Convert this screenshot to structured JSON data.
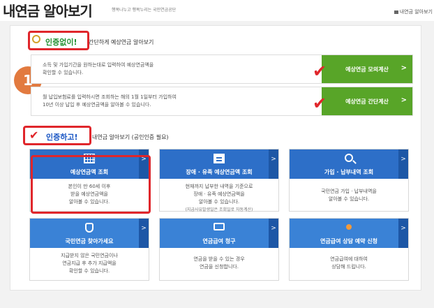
{
  "header": {
    "title": "내연금 알아보기",
    "subtitle": "행복나누고 행복누리는 국민연금공단",
    "breadcrumb": "내연금 알아보기"
  },
  "annotation": {
    "step_number": "1"
  },
  "section_no_auth": {
    "label": "인증없이!",
    "description": "간단하게 예상연금 알아보기",
    "rows": [
      {
        "text_line1": "소득 및 가입기간을 원하는대로 입력하여 예상연금액을",
        "text_line2": "확인할 수 있습니다.",
        "button": "예상연금 모의계산"
      },
      {
        "text_line1": "월 납입보험료를 입력하시면 조회하는 해의 1월 1일부터 가입하여",
        "text_line2": "10년 이상 납입 후 예상연금액을 알아볼 수 있습니다.",
        "button": "예상연금 간단계산"
      }
    ]
  },
  "section_auth": {
    "label": "인증하고!",
    "description": "내연금 알아보기 (공인인증 필요)",
    "cards": [
      {
        "title": "예상연금액 조회",
        "icon": "grid-icon",
        "body": [
          "본인이 만 60세 이후",
          "받을 예상연금액을",
          "알아볼 수 있습니다."
        ],
        "note": ""
      },
      {
        "title": "장애 · 유족 예상연금액 조회",
        "icon": "document-icon",
        "body": [
          "현재까지 납부한 내역을 기준으로",
          "장애 · 유족 예상연금액을",
          "알아볼 수 있습니다."
        ],
        "note": "(지급사유발생일은 조회일로 자동계산)"
      },
      {
        "title": "가입 · 납부내역 조회",
        "icon": "search-icon",
        "body": [
          "국민연금 가입 · 납부내역을",
          "알아볼 수 있습니다."
        ],
        "note": ""
      },
      {
        "title": "국민연금 찾아가세요",
        "icon": "jar-icon",
        "body": [
          "지급받지 않은 국민연금이나",
          "연금지급 후 추가 지급액을",
          "확인할 수 있습니다."
        ],
        "note": ""
      },
      {
        "title": "연금급여 청구",
        "icon": "computer-icon",
        "body": [
          "연금을 받을 수 있는 경우",
          "연금을 신청합니다."
        ],
        "note": ""
      },
      {
        "title": "연금급여 상담 예약 신청",
        "icon": "consult-icon",
        "body": [
          "연금급여에 대하여",
          "상담해 드립니다."
        ],
        "note": ""
      }
    ]
  }
}
